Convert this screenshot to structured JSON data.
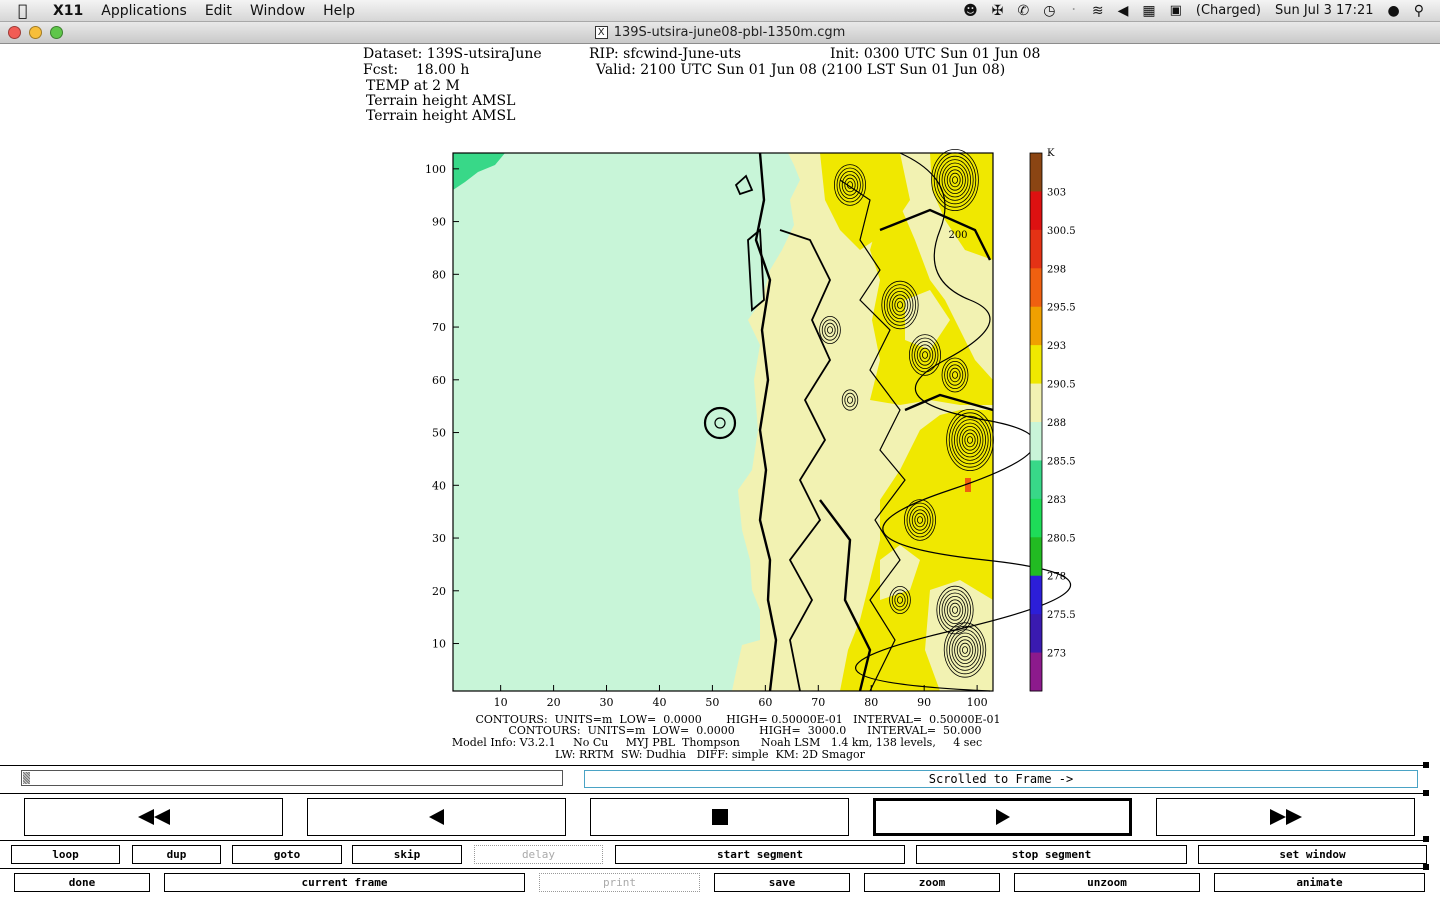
{
  "menubar": {
    "app": "X11",
    "items": [
      "Applications",
      "Edit",
      "Window",
      "Help"
    ],
    "battery": "(Charged)",
    "clock": "Sun Jul 3  17:21"
  },
  "window": {
    "title": "139S-utsira-june08-pbl-1350m.cgm"
  },
  "plot_header": {
    "dataset": "Dataset: 139S-utsiraJune",
    "rip": "RIP: sfcwind-June-uts",
    "init": "Init: 0300 UTC Sun 01 Jun 08",
    "fcst": "Fcst:    18.00 h",
    "valid": "Valid: 2100 UTC Sun 01 Jun 08 (2100 LST Sun 01 Jun 08)",
    "field1": "TEMP at 2 M",
    "field2": "Terrain height AMSL",
    "field3": "Terrain height AMSL"
  },
  "plot_footer": {
    "line1": "CONTOURS:  UNITS=m  LOW=  0.0000       HIGH= 0.50000E-01   INTERVAL=  0.50000E-01",
    "line2": "CONTOURS:  UNITS=m  LOW=  0.0000       HIGH=  3000.0      INTERVAL=  50.000",
    "line3": "Model Info: V3.2.1     No Cu     MYJ PBL  Thompson      Noah LSM   1.4 km, 138 levels,     4 sec",
    "line4": "LW: RRTM  SW: Dudhia   DIFF: simple  KM: 2D Smagor"
  },
  "chart_data": {
    "type": "heatmap",
    "x_ticks": [
      "10",
      "20",
      "30",
      "40",
      "50",
      "60",
      "70",
      "80",
      "90",
      "100"
    ],
    "y_ticks": [
      "10",
      "20",
      "30",
      "40",
      "50",
      "60",
      "70",
      "80",
      "90",
      "100"
    ],
    "xlim": [
      1,
      103
    ],
    "ylim": [
      1,
      103
    ],
    "contour_label": "200",
    "colorbar": {
      "unit": "K",
      "labels": [
        "303",
        "300.5",
        "298",
        "295.5",
        "293",
        "290.5",
        "288",
        "285.5",
        "283",
        "280.5",
        "278",
        "275.5",
        "273"
      ],
      "colors": [
        "#8b4513",
        "#dd1111",
        "#e43215",
        "#f06010",
        "#f0a000",
        "#f0e800",
        "#f2f2b2",
        "#c8f5d8",
        "#38d888",
        "#1edc58",
        "#22bb22",
        "#2c1ed8",
        "#3a1ab0",
        "#8c1a8c"
      ]
    }
  },
  "controls": {
    "status": "Scrolled to Frame ->",
    "row1": [
      "loop",
      "dup",
      "goto",
      "skip",
      "delay",
      "start segment",
      "stop segment",
      "set window"
    ],
    "row2": [
      "done",
      "current frame",
      "print",
      "save",
      "zoom",
      "unzoom",
      "animate"
    ]
  }
}
